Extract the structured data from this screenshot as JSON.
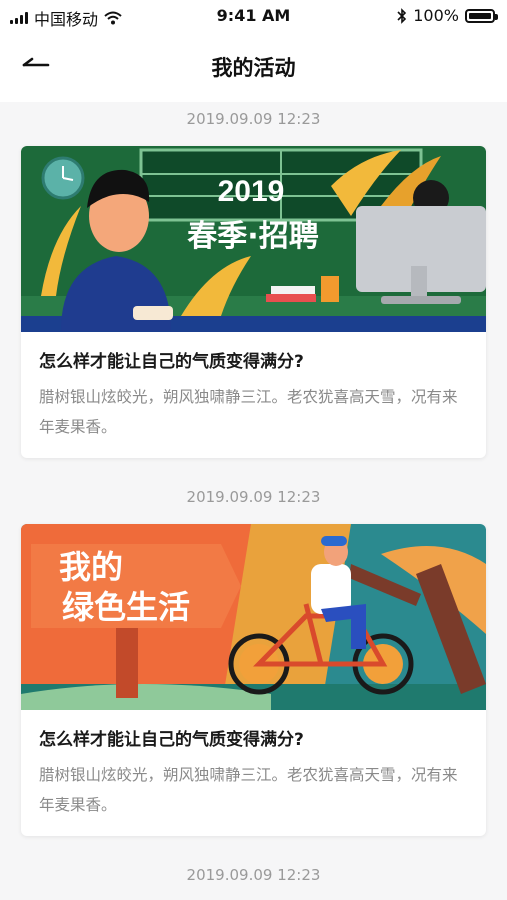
{
  "status_bar": {
    "carrier": "中国移动",
    "time": "9:41 AM",
    "battery_percent": "100%",
    "battery_level": 1.0
  },
  "nav": {
    "title": "我的活动",
    "back_icon": "arrow-left-icon"
  },
  "activities": [
    {
      "timestamp": "2019.09.09 12:23",
      "banner": {
        "year": "2019",
        "headline": "春季·招聘",
        "theme_color": "#1d6a3a"
      },
      "title": "怎么样才能让自己的气质变得满分?",
      "description": "腊树银山炫皎光，朔风独啸静三江。老农犹喜高天雪，况有来年麦果香。"
    },
    {
      "timestamp": "2019.09.09 12:23",
      "banner": {
        "headline": "我的绿色生活",
        "theme_color": "#ef6b3a"
      },
      "title": "怎么样才能让自己的气质变得满分?",
      "description": "腊树银山炫皎光，朔风独啸静三江。老农犹喜高天雪，况有来年麦果香。"
    }
  ],
  "trailing_timestamp": "2019.09.09 12:23"
}
